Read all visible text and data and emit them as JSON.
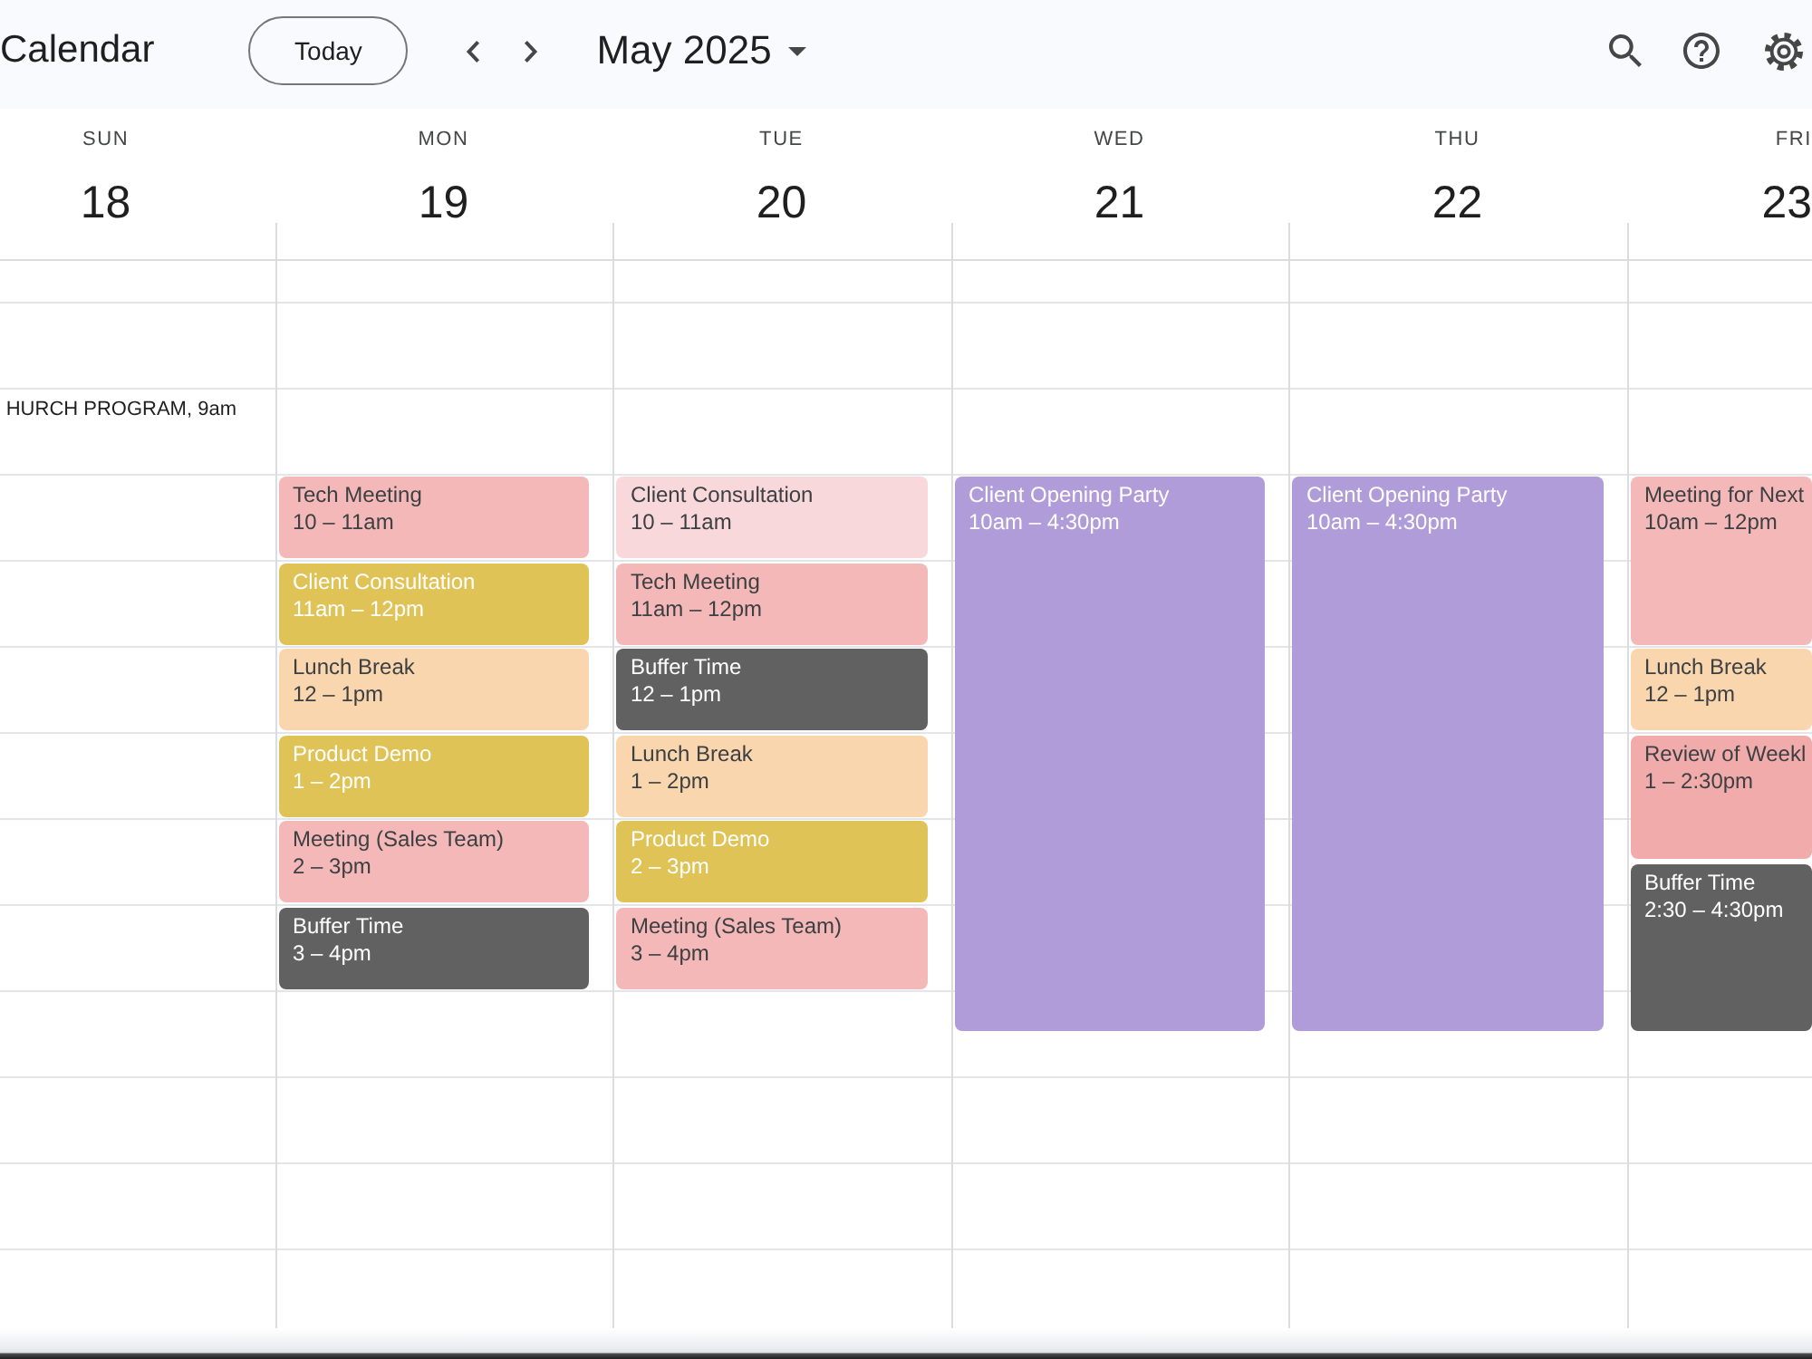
{
  "app": {
    "title": "Calendar"
  },
  "toolbar": {
    "today_button": "Today",
    "period": "May 2025"
  },
  "days": [
    {
      "name": "SUN",
      "date": "18",
      "events": [
        {
          "kind": "compact",
          "title": "HURCH PROGRAM,",
          "time": "9am"
        }
      ]
    },
    {
      "name": "MON",
      "date": "19",
      "events": [
        {
          "kind": "block",
          "title": "Tech Meeting",
          "time": "10 – 11am",
          "color": "#f4b8b8"
        },
        {
          "kind": "block",
          "title": "Client Consultation",
          "time": "11am – 12pm",
          "color": "#e0c356"
        },
        {
          "kind": "block",
          "title": "Lunch Break",
          "time": "12 – 1pm",
          "color": "#f9d6ae"
        },
        {
          "kind": "block",
          "title": "Product Demo",
          "time": "1 – 2pm",
          "color": "#e0c356"
        },
        {
          "kind": "block",
          "title": "Meeting (Sales Team)",
          "time": "2 – 3pm",
          "color": "#f4b8b8"
        },
        {
          "kind": "block",
          "title": "Buffer Time",
          "time": "3 – 4pm",
          "color": "#616161"
        }
      ]
    },
    {
      "name": "TUE",
      "date": "20",
      "events": [
        {
          "kind": "block",
          "title": "Client Consultation",
          "time": "10 – 11am",
          "color": "#f8d8da"
        },
        {
          "kind": "block",
          "title": "Tech Meeting",
          "time": "11am – 12pm",
          "color": "#f4b8b8"
        },
        {
          "kind": "block",
          "title": "Buffer Time",
          "time": "12 – 1pm",
          "color": "#616161"
        },
        {
          "kind": "block",
          "title": "Lunch Break",
          "time": "1 – 2pm",
          "color": "#f9d6ae"
        },
        {
          "kind": "block",
          "title": "Product Demo",
          "time": "2 – 3pm",
          "color": "#e0c356"
        },
        {
          "kind": "block",
          "title": "Meeting (Sales Team)",
          "time": "3 – 4pm",
          "color": "#f4b8b8"
        }
      ]
    },
    {
      "name": "WED",
      "date": "21",
      "events": [
        {
          "kind": "block",
          "title": "Client Opening Party",
          "time": "10am – 4:30pm",
          "color": "#b09cd8"
        }
      ]
    },
    {
      "name": "THU",
      "date": "22",
      "events": [
        {
          "kind": "block",
          "title": "Client Opening Party",
          "time": "10am – 4:30pm",
          "color": "#b09cd8"
        }
      ]
    },
    {
      "name": "FRI",
      "date": "23",
      "events": [
        {
          "kind": "block",
          "title": "Meeting for Next",
          "time": "10am – 12pm",
          "color": "#f4b8b8"
        },
        {
          "kind": "block",
          "title": "Lunch Break",
          "time": "12 – 1pm",
          "color": "#f9d6ae"
        },
        {
          "kind": "block",
          "title": "Review of Weekl",
          "time": "1 – 2:30pm",
          "color": "#f2abab"
        },
        {
          "kind": "block",
          "title": "Buffer Time",
          "time": "2:30 – 4:30pm",
          "color": "#616161"
        }
      ]
    }
  ]
}
